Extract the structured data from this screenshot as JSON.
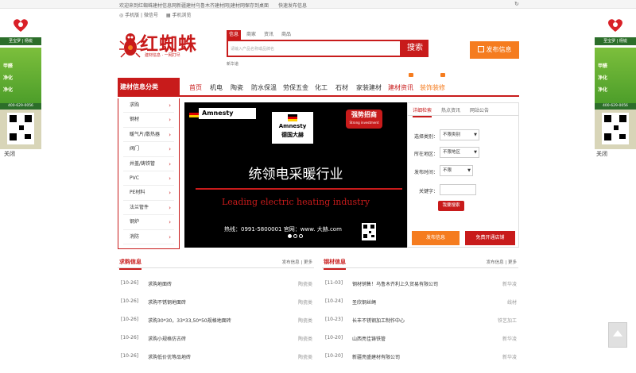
{
  "topbar": {
    "welcome": "欢迎来到红蜘蛛建材信息网新疆建材乌鲁木齐建材网|建材网！",
    "links": [
      "保存到桌面",
      "快速发布信息"
    ]
  },
  "subbar": {
    "items": [
      "◎ 手机版 | 微信号",
      "▦ 手机浏览"
    ]
  },
  "logo": {
    "name": "红蜘蛛",
    "slogan": "建材信息 · 一网打尽"
  },
  "search": {
    "tabs": [
      "信息",
      "商家",
      "资讯",
      "商品"
    ],
    "active_tab": "信息",
    "placeholder": "请输入产品名称或品牌名",
    "button": "搜索",
    "hot_label": "新华道"
  },
  "publish_button": "发布信息",
  "nav": {
    "category_head": "建材信息分类",
    "items": [
      "首页",
      "机电",
      "陶瓷",
      "防水保温",
      "劳保五金",
      "化工",
      "石材",
      "家装建材",
      "建材资讯",
      "装饰装修"
    ],
    "active": "首页"
  },
  "categories": [
    "求购",
    "钢材",
    "暖气片/散热器",
    "阀门",
    "井盖/铸铁管",
    "PVC",
    "PE材料",
    "法兰管件",
    "钢炉",
    "消防"
  ],
  "banner": {
    "brand": "Amnesty",
    "center_brand": "Amnesty",
    "center_cn": "德国大赫",
    "recruit": "强势招商",
    "recruit_en": "Strong investment",
    "slogan_cn": "统领电采暖行业",
    "slogan_en": "Leading electric heating industry",
    "contact": "热线：0991-5800001    官网：www. 大赫.com"
  },
  "panel": {
    "tabs": [
      "详细检索",
      "热点资讯",
      "网站公告"
    ],
    "active_tab": "详细检索",
    "fields": [
      {
        "label": "选择类别：",
        "value": "不限类别"
      },
      {
        "label": "所在地区：",
        "value": "不限地区"
      },
      {
        "label": "发布时间：",
        "value": "不限"
      },
      {
        "label": "关键字：",
        "value": ""
      }
    ],
    "search_button": "我要搜索",
    "publish_button": "发布信息",
    "shop_button": "免费开通店铺"
  },
  "purchase": {
    "title": "求购信息",
    "more": "发布信息 | 更多",
    "rows": [
      {
        "date": "[10-26]",
        "title": "求购地面砖",
        "src": "陶瓷类"
      },
      {
        "date": "[10-26]",
        "title": "求购不锈钢地面砖",
        "src": "陶瓷类"
      },
      {
        "date": "[10-26]",
        "title": "求购30*30，33*33,50*50规格地面砖",
        "src": "陶瓷类"
      },
      {
        "date": "[10-26]",
        "title": "求购小规格仿古砖",
        "src": "陶瓷类"
      },
      {
        "date": "[10-26]",
        "title": "求购低价优等品地砖",
        "src": "陶瓷类"
      }
    ]
  },
  "steel": {
    "title": "钢材信息",
    "more": "发布信息 | 更多",
    "rows": [
      {
        "date": "[11-03]",
        "title": "钢材销售！乌鲁木齐利上久贸易有限公司",
        "src": "新华凌"
      },
      {
        "date": "[10-24]",
        "title": "圣欣钢丝绳",
        "src": "线材"
      },
      {
        "date": "[10-23]",
        "title": "长丰不锈钢加工制作中心",
        "src": "铁艺加工"
      },
      {
        "date": "[10-20]",
        "title": "山西亮佳铸铁管",
        "src": "新华凌"
      },
      {
        "date": "[10-20]",
        "title": "新疆亮盛建材有限公司",
        "src": "新华凌"
      }
    ]
  },
  "side_ad": {
    "brand": "圣宝罗 | 杨锐",
    "lines": [
      "甲醛",
      "净化",
      "净化"
    ],
    "tel": "400-629-0056",
    "close": "关闭"
  },
  "colors": {
    "brand_red": "#c81b1b",
    "orange": "#f57c1f"
  }
}
